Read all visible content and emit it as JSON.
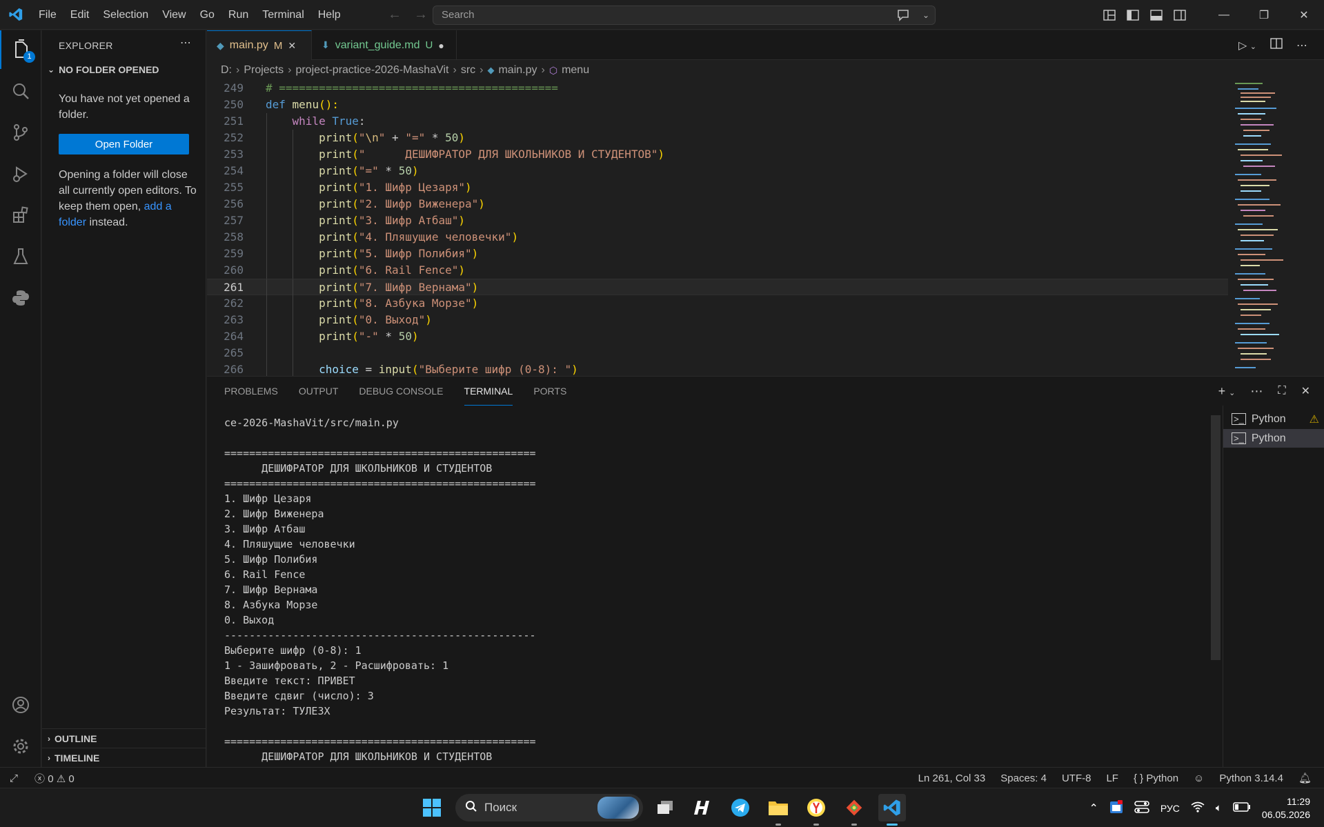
{
  "titlebar": {
    "menu": [
      "File",
      "Edit",
      "Selection",
      "View",
      "Go",
      "Run",
      "Terminal",
      "Help"
    ],
    "search_placeholder": "Search"
  },
  "activity": {
    "explorer_badge": "1"
  },
  "sidebar": {
    "title": "EXPLORER",
    "no_folder_header": "NO FOLDER OPENED",
    "no_folder_msg": "You have not yet opened a folder.",
    "open_folder_label": "Open Folder",
    "note_before": "Opening a folder will close all currently open editors. To keep them open,",
    "note_link": "add a folder",
    "note_after": "instead.",
    "outline": "OUTLINE",
    "timeline": "TIMELINE"
  },
  "tabs": [
    {
      "label": "main.py",
      "status": "M"
    },
    {
      "label": "variant_guide.md",
      "status": "U"
    }
  ],
  "breadcrumb": [
    "D:",
    "Projects",
    "project-practice-2026-MashaVit",
    "src",
    "main.py",
    "menu"
  ],
  "code": {
    "line_numbers": [
      "249",
      "250",
      "251",
      "252",
      "253",
      "254",
      "255",
      "256",
      "257",
      "258",
      "259",
      "260",
      "261",
      "262",
      "263",
      "264",
      "265",
      "266"
    ],
    "comment_249": "# ==========================================",
    "def_kw": "def",
    "def_name": "menu",
    "def_rest": "():",
    "while_kw": "while",
    "while_true": "True",
    "colon": ":",
    "print": "print",
    "s252": "\"\\n\"",
    "s252b": "\"=\"",
    "n50": "50",
    "s253": "\"      ДЕШИФРАТОР ДЛЯ ШКОЛЬНИКОВ И СТУДЕНТОВ\"",
    "s254": "\"=\"",
    "s255": "\"1. Шифр Цезаря\"",
    "s256": "\"2. Шифр Виженера\"",
    "s257": "\"3. Шифр Атбаш\"",
    "s258": "\"4. Пляшущие человечки\"",
    "s259": "\"5. Шифр Полибия\"",
    "s260": "\"6. Rail Fence\"",
    "s261": "\"7. Шифр Вернама\"",
    "s262": "\"8. Азбука Морзе\"",
    "s263": "\"0. Выход\"",
    "s264": "\"-\"",
    "choice_var": "choice",
    "input_fn": "input",
    "s266": "\"Выберите шифр (0-8): \""
  },
  "panel": {
    "tabs": [
      "PROBLEMS",
      "OUTPUT",
      "DEBUG CONSOLE",
      "TERMINAL",
      "PORTS"
    ],
    "active_tab": "TERMINAL",
    "terminal_lines": [
      "ce-2026-MashaVit/src/main.py",
      "",
      "==================================================",
      "      ДЕШИФРАТОР ДЛЯ ШКОЛЬНИКОВ И СТУДЕНТОВ",
      "==================================================",
      "1. Шифр Цезаря",
      "2. Шифр Виженера",
      "3. Шифр Атбаш",
      "4. Пляшущие человечки",
      "5. Шифр Полибия",
      "6. Rail Fence",
      "7. Шифр Вернама",
      "8. Азбука Морзе",
      "0. Выход",
      "--------------------------------------------------",
      "Выберите шифр (0-8): 1",
      "1 - Зашифровать, 2 - Расшифровать: 1",
      "Введите текст: ПРИВЕТ",
      "Введите сдвиг (число): 3",
      "Результат: ТУЛЕЗХ",
      "",
      "==================================================",
      "      ДЕШИФРАТОР ДЛЯ ШКОЛЬНИКОВ И СТУДЕНТОВ"
    ],
    "terminals": [
      "Python",
      "Python"
    ]
  },
  "statusbar": {
    "errors": "0",
    "warnings": "0",
    "position": "Ln 261, Col 33",
    "spaces": "Spaces: 4",
    "encoding": "UTF-8",
    "eol": "LF",
    "language": "Python",
    "interpreter": "Python 3.14.4"
  },
  "taskbar": {
    "search_label": "Поиск",
    "lang": "РУС",
    "time": "11:29",
    "date": "06.05.2026"
  },
  "colors": {
    "accent": "#0078d4",
    "editor_bg": "#1f1f1f",
    "sidebar_bg": "#181818",
    "modified": "#e2c08d",
    "untracked": "#73c991"
  }
}
